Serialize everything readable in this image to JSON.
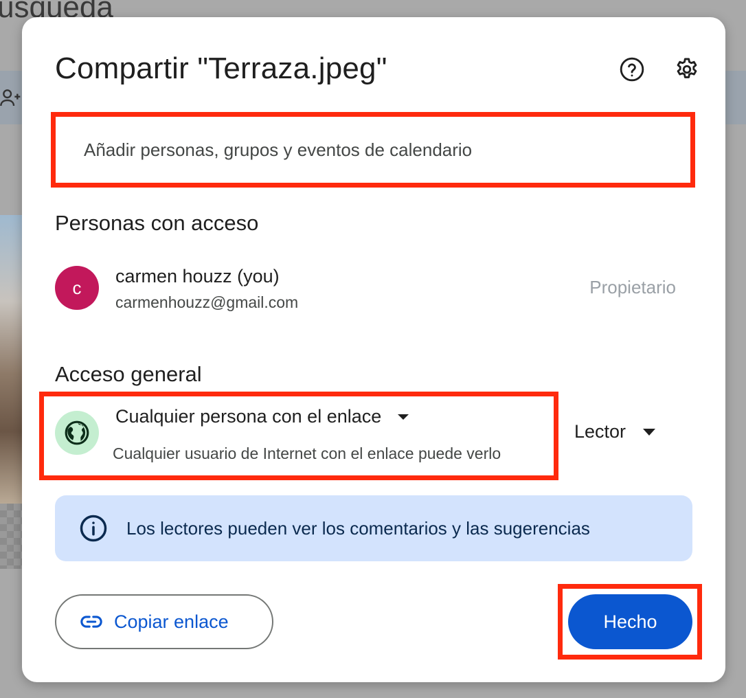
{
  "background": {
    "title_fragment": "úsqueda"
  },
  "dialog": {
    "title": "Compartir \"Terraza.jpeg\"",
    "help_icon": "help-circle-icon",
    "settings_icon": "gear-icon",
    "add_people": {
      "placeholder": "Añadir personas, grupos y eventos de calendario"
    },
    "people_section": {
      "title": "Personas con acceso",
      "people": [
        {
          "initial": "c",
          "name": "carmen houzz (you)",
          "email": "carmenhouzz@gmail.com",
          "role": "Propietario",
          "avatar_color": "#c2185b"
        }
      ]
    },
    "general_access": {
      "title": "Acceso general",
      "option": "Cualquier persona con el enlace",
      "description": "Cualquier usuario de Internet con el enlace puede verlo",
      "role": "Lector",
      "icon": "globe-icon"
    },
    "info_banner": {
      "text": "Los lectores pueden ver los comentarios y las sugerencias",
      "icon": "info-icon"
    },
    "copy_link_label": "Copiar enlace",
    "done_label": "Hecho"
  },
  "colors": {
    "accent": "#0b57d0",
    "highlight": "#ff2a0d",
    "banner_bg": "#d3e3fd",
    "globe_bg": "#c4eed0"
  }
}
